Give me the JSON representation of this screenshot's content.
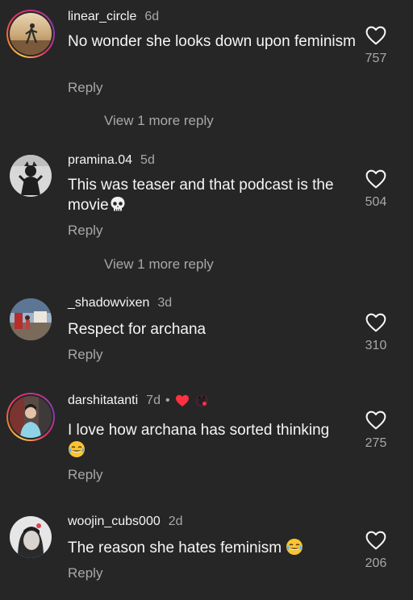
{
  "comments": [
    {
      "username": "linear_circle",
      "age": "6d",
      "text": "No wonder she looks down upon feminism",
      "reply_label": "Reply",
      "likes": "757",
      "view_more": "View 1 more reply"
    },
    {
      "username": "pramina.04",
      "age": "5d",
      "text": "This was teaser and that podcast is the movie",
      "reply_label": "Reply",
      "likes": "504",
      "view_more": "View 1 more reply"
    },
    {
      "username": "_shadowvixen",
      "age": "3d",
      "text": "Respect for archana",
      "reply_label": "Reply",
      "likes": "310"
    },
    {
      "username": "darshitatanti",
      "age": "7d",
      "text": "I love how archana has sorted thinking",
      "reply_label": "Reply",
      "likes": "275"
    },
    {
      "username": "woojin_cubs000",
      "age": "2d",
      "text": "The reason she hates feminism",
      "reply_label": "Reply",
      "likes": "206"
    }
  ],
  "colors": {
    "background": "#262626",
    "text_primary": "#f5f5f5",
    "text_secondary": "#a8a8a8",
    "heart_badge": "#ff3040"
  },
  "icons": {
    "like": "heart-outline-icon",
    "skull": "skull-emoji",
    "laugh": "tears-of-joy-emoji",
    "red_heart": "red-heart-emoji",
    "creator_badge": "creator-avatar-badge"
  }
}
